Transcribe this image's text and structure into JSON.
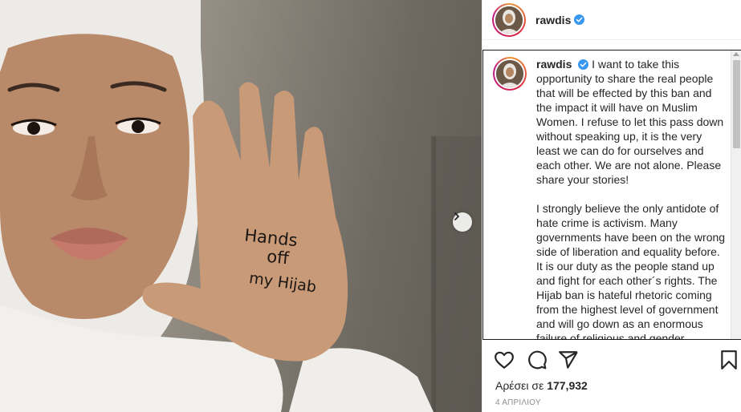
{
  "post": {
    "username": "rawdis",
    "verified": true,
    "photo_handwriting": [
      "Hands",
      "off",
      "my Hijab"
    ],
    "caption_paragraphs": [
      "I want to take this opportunity to share the real people that will be effected by this ban and the impact it will have on Muslim Women. I refuse to let this pass down without speaking up, it is the very least we can do for ourselves and each other. We are not alone. Please share your stories!",
      "I strongly believe the only antidote of hate crime is activism. Many governments have been on the wrong side of liberation and equality before. It is our duty as the people stand up and fight for each other´s rights. The Hijab ban is hateful rhetoric coming from the highest level of government and will go down as an enormous failure of religious and gender equality."
    ],
    "likes_label": "Αρέσει σε",
    "likes_count": "177,932",
    "date": "4 ΑΠΡΙΛΙΟΥ"
  },
  "icons": {
    "like": "heart-icon",
    "comment": "comment-icon",
    "share": "share-icon",
    "save": "bookmark-icon",
    "next": "chevron-right-icon",
    "verified": "verified-badge-icon"
  },
  "colors": {
    "verified": "#3897f0",
    "text": "#262626",
    "muted": "#8e8e8e",
    "border": "#efefef"
  }
}
